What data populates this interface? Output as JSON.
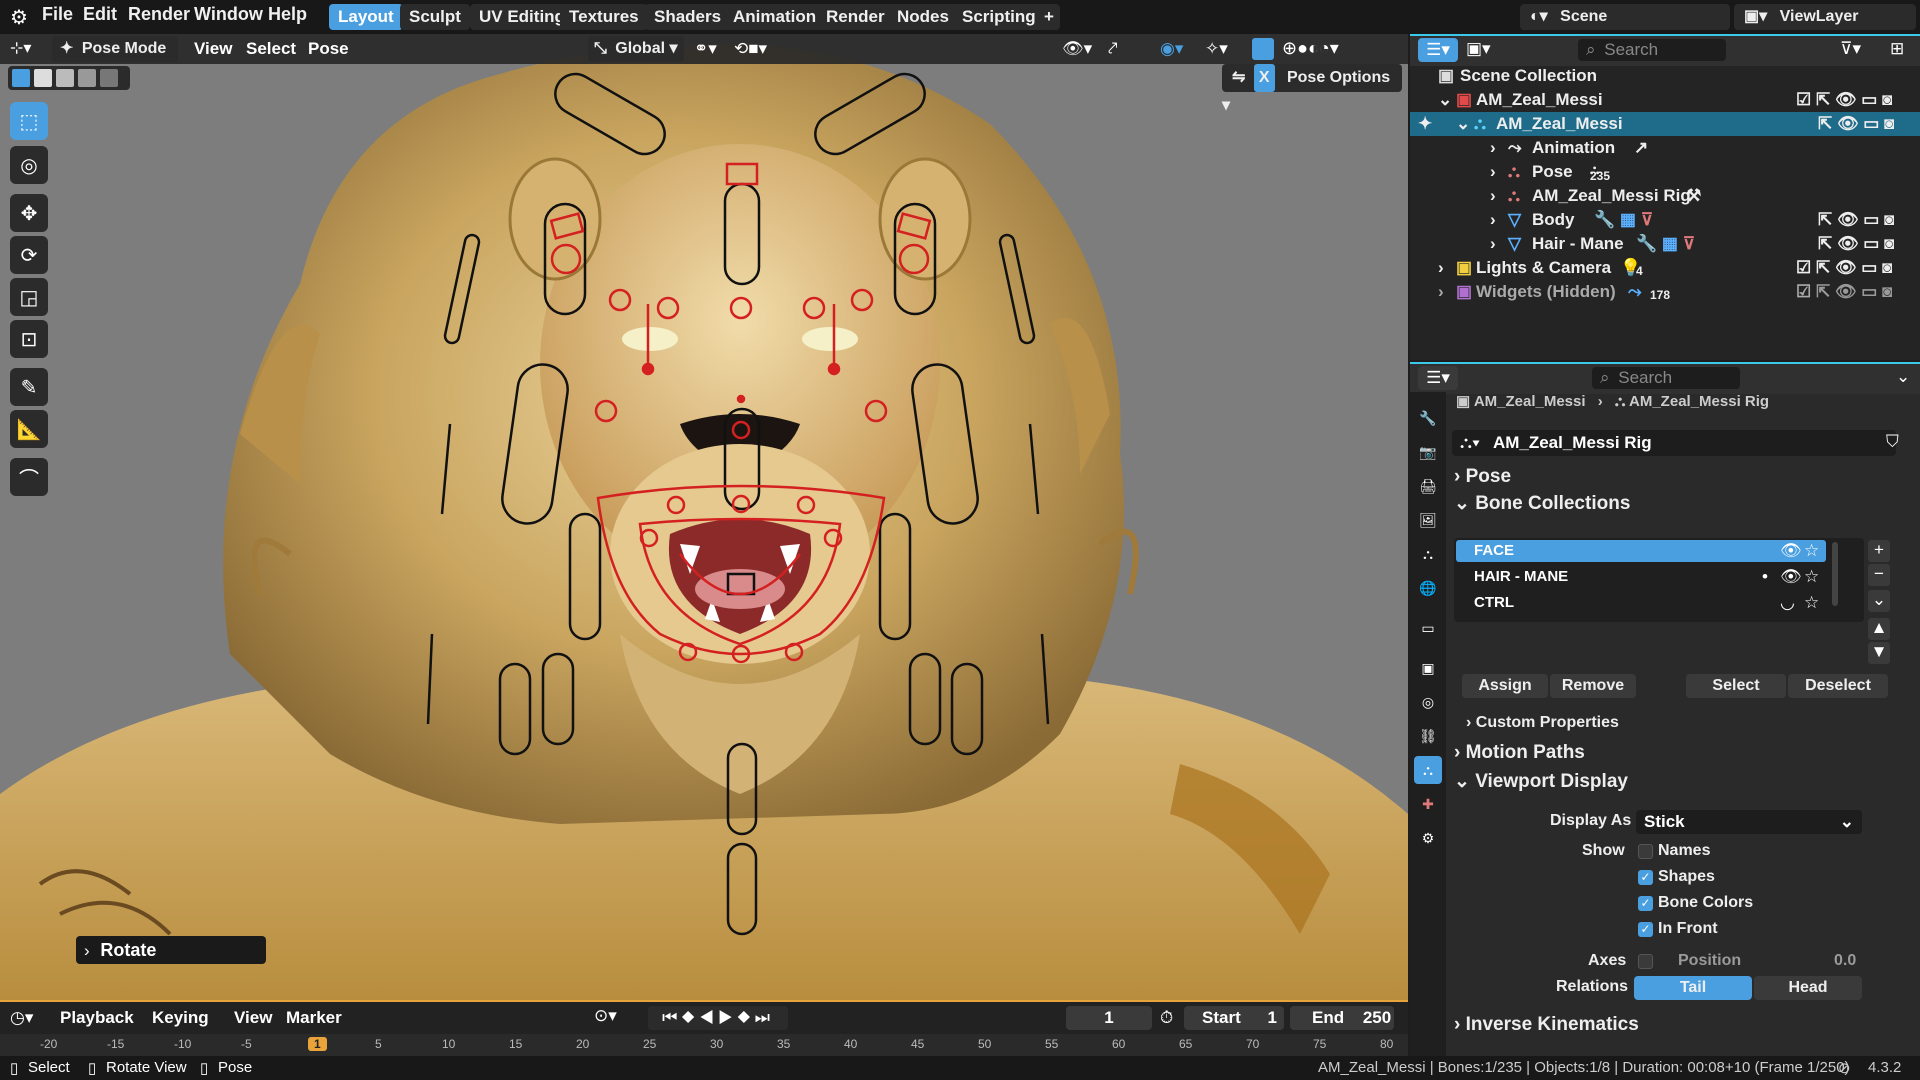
{
  "top_menu": [
    "File",
    "Edit",
    "Render",
    "Window",
    "Help"
  ],
  "workspace_tabs": [
    {
      "label": "Layout",
      "active": true
    },
    {
      "label": "Sculpt",
      "active": false
    },
    {
      "label": "UV Editing",
      "active": false
    },
    {
      "label": "Textures",
      "active": false
    },
    {
      "label": "Shaders",
      "active": false
    },
    {
      "label": "Animation",
      "active": false
    },
    {
      "label": "Render",
      "active": false
    },
    {
      "label": "Nodes",
      "active": false
    },
    {
      "label": "Scripting",
      "active": false
    }
  ],
  "scene": {
    "label": "Scene",
    "view_layer": "ViewLayer"
  },
  "viewport_header": {
    "mode": "Pose Mode",
    "menus": [
      "View",
      "Select",
      "Pose"
    ],
    "transform_orientation": "Global",
    "pose_options": "Pose Options",
    "x_label": "X"
  },
  "operator_panel": {
    "label": "Rotate"
  },
  "outliner": {
    "search_placeholder": "Search",
    "rows": [
      {
        "label": "Scene Collection",
        "indent": 0
      },
      {
        "label": "AM_Zeal_Messi",
        "indent": 1
      },
      {
        "label": "AM_Zeal_Messi",
        "indent": 2,
        "selected": true
      },
      {
        "label": "Animation",
        "indent": 3
      },
      {
        "label": "Pose",
        "indent": 3,
        "badge": "235"
      },
      {
        "label": "AM_Zeal_Messi Rig",
        "indent": 3
      },
      {
        "label": "Body",
        "indent": 3
      },
      {
        "label": "Hair - Mane",
        "indent": 3
      },
      {
        "label": "Lights & Camera",
        "indent": 1,
        "badge": "4"
      },
      {
        "label": "Widgets (Hidden)",
        "indent": 1,
        "badge": "178",
        "dim": true
      }
    ]
  },
  "properties": {
    "search_placeholder": "Search",
    "breadcrumb": [
      "AM_Zeal_Messi",
      "AM_Zeal_Messi Rig"
    ],
    "data_name": "AM_Zeal_Messi Rig",
    "panels": {
      "pose": "Pose",
      "bone_collections": "Bone Collections",
      "motion_paths": "Motion Paths",
      "viewport_display": "Viewport Display",
      "inverse_kinematics": "Inverse Kinematics",
      "custom_properties": "Custom Properties"
    },
    "collections": [
      {
        "label": "FACE",
        "selected": true
      },
      {
        "label": "HAIR - MANE",
        "selected": false
      },
      {
        "label": "CTRL",
        "selected": false
      }
    ],
    "collection_buttons": [
      "Assign",
      "Remove",
      "Select",
      "Deselect"
    ],
    "display_as_label": "Display As",
    "display_as_value": "Stick",
    "show_label": "Show",
    "show_options": [
      {
        "label": "Names",
        "checked": false
      },
      {
        "label": "Shapes",
        "checked": true
      },
      {
        "label": "Bone Colors",
        "checked": true
      },
      {
        "label": "In Front",
        "checked": true
      }
    ],
    "axes_label": "Axes",
    "axes_position_label": "Position",
    "axes_position_value": "0.0",
    "relations_label": "Relations",
    "relations": [
      {
        "label": "Tail",
        "active": true
      },
      {
        "label": "Head",
        "active": false
      }
    ]
  },
  "timeline": {
    "menus": [
      "Playback",
      "Keying",
      "View",
      "Marker"
    ],
    "current_frame": "1",
    "start_label": "Start",
    "start": "1",
    "end_label": "End",
    "end": "250",
    "ruler": [
      "-20",
      "-15",
      "-10",
      "-5",
      "1",
      "5",
      "10",
      "15",
      "20",
      "25",
      "30",
      "35",
      "40",
      "45",
      "50",
      "55",
      "60",
      "65",
      "70",
      "75",
      "80"
    ]
  },
  "status_bar": {
    "hints": [
      "Select",
      "Rotate View",
      "Pose"
    ],
    "info": "AM_Zeal_Messi | Bones:1/235 | Objects:1/8 | Duration: 00:08+10 (Frame 1/250)",
    "version": "4.3.2"
  },
  "colors": {
    "accent": "#4a9fe0",
    "outliner_accent": "#3cc8e8",
    "timeline_accent": "#e8a43a",
    "bone_red": "#d42020",
    "fur": "#c9a55f"
  }
}
